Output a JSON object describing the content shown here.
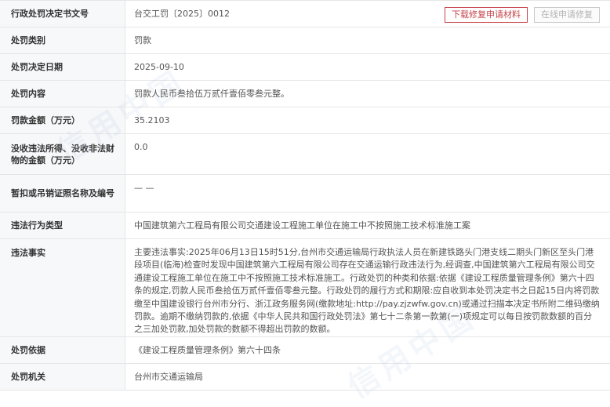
{
  "rows": {
    "doc_no": {
      "label": "行政处罚决定书文号",
      "value": "台交工罚〔2025〕0012"
    },
    "category": {
      "label": "处罚类别",
      "value": "罚款"
    },
    "date": {
      "label": "处罚决定日期",
      "value": "2025-09-10"
    },
    "content": {
      "label": "处罚内容",
      "value": "罚款人民币叁拾伍万贰仟壹佰零叁元整。"
    },
    "fine": {
      "label": "罚款金额（万元）",
      "value": "35.2103"
    },
    "confiscate": {
      "label": "没收违法所得、没收非法财物的金额（万元）",
      "value": "0.0"
    },
    "license": {
      "label": "暂扣或吊销证照名称及编号",
      "value": "— —"
    },
    "violation_type": {
      "label": "违法行为类型",
      "value": "中国建筑第六工程局有限公司交通建设工程施工单位在施工中不按照施工技术标准施工案"
    },
    "facts": {
      "label": "违法事实",
      "value": "主要违法事实:2025年06月13日15时51分,台州市交通运输局行政执法人员在新建铁路头门港支线二期头门新区至头门港段项目(临海)检查时发现中国建筑第六工程局有限公司存在交通运输行政违法行为,经调查,中国建筑第六工程局有限公司交通建设工程施工单位在施工中不按照施工技术标准施工。行政处罚的种类和依据:依据《建设工程质量管理条例》第六十四条的规定,罚款人民币叁拾伍万贰仟壹佰零叁元整。行政处罚的履行方式和期限:应自收到本处罚决定书之日起15日内将罚款缴至中国建设银行台州市分行、浙江政务服务网(缴款地址:http://pay.zjzwfw.gov.cn)或通过扫描本决定书所附二维码缴纳罚款。逾期不缴纳罚款的,依据《中华人民共和国行政处罚法》第七十二条第一款第(一)项规定可以每日按罚款数额的百分之三加处罚款,加处罚款的数额不得超出罚款的数额。"
    },
    "basis": {
      "label": "处罚依据",
      "value": "《建设工程质量管理条例》第六十四条"
    },
    "authority": {
      "label": "处罚机关",
      "value": "台州市交通运输局"
    }
  },
  "buttons": {
    "download": "下载修复申请材料",
    "online_repair": "在线申请修复"
  },
  "watermark": "信用中国",
  "colors": {
    "download_border": "#c6434a",
    "label_bg": "#f7f8fa",
    "border": "#e6e6e6"
  }
}
